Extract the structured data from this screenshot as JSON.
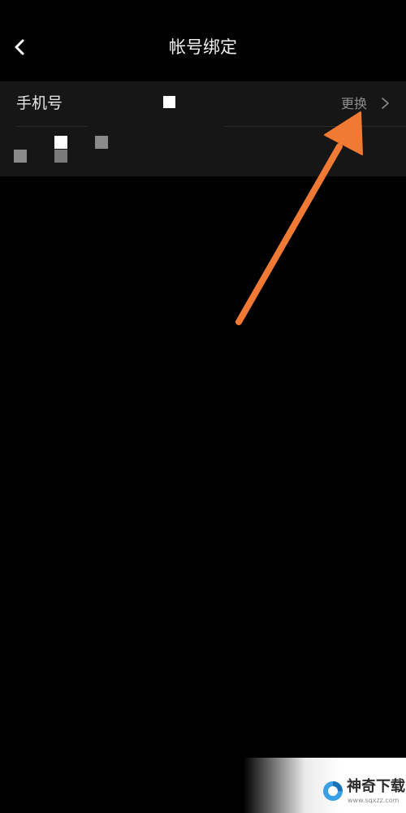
{
  "header": {
    "title": "帐号绑定",
    "back_icon": "chevron-left-icon"
  },
  "account": {
    "phone_label": "手机号",
    "change_label": "更换",
    "change_icon": "chevron-right-icon"
  },
  "annotation": {
    "arrow_color": "#f07a33"
  },
  "watermark": {
    "title": "神奇下载",
    "url": "www.sqxzz.com"
  },
  "colors": {
    "background": "#000000",
    "panel": "#161616",
    "muted_text": "#8e8e8e"
  }
}
